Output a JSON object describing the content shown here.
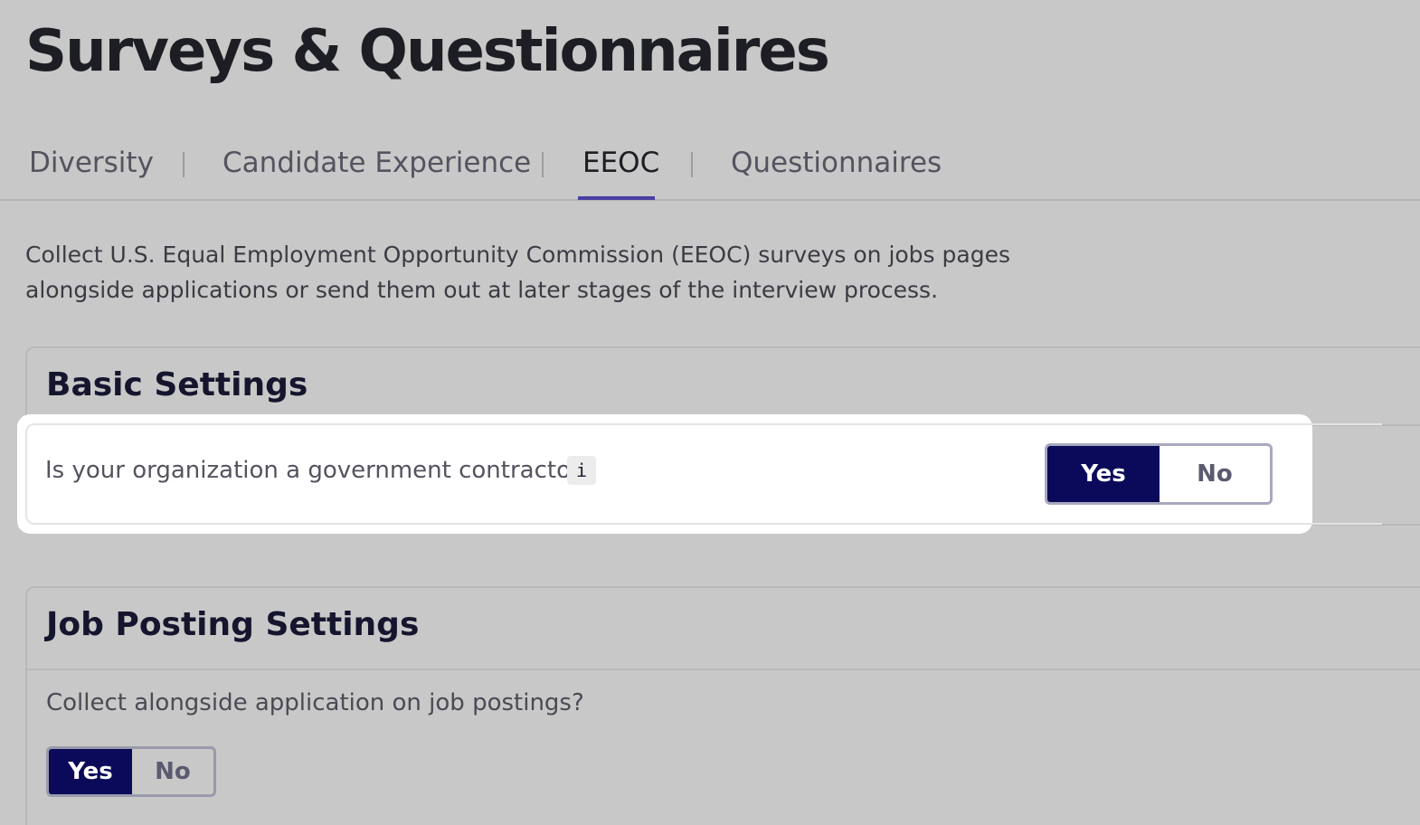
{
  "page_title": "Surveys & Questionnaires",
  "tabs": [
    {
      "label": "Diversity",
      "active": false
    },
    {
      "label": "Candidate Experience",
      "active": false
    },
    {
      "label": "EEOC",
      "active": true
    },
    {
      "label": "Questionnaires",
      "active": false
    }
  ],
  "intro": "Collect U.S. Equal Employment Opportunity Commission (EEOC) surveys on jobs pages alongside applications or send them out at later stages of the interview process.",
  "basic_settings": {
    "title": "Basic Settings",
    "question": "Is your organization a government contractor?",
    "info_icon": "i",
    "toggle": {
      "yes_label": "Yes",
      "no_label": "No",
      "selected": "Yes"
    }
  },
  "job_posting_settings": {
    "title": "Job Posting Settings",
    "question": "Collect alongside application on job postings?",
    "toggle": {
      "yes_label": "Yes",
      "no_label": "No",
      "selected": "Yes"
    }
  },
  "colors": {
    "accent": "#4a3fa3",
    "toggle_active": "#0b0a5a",
    "background": "#c8c8c8"
  }
}
